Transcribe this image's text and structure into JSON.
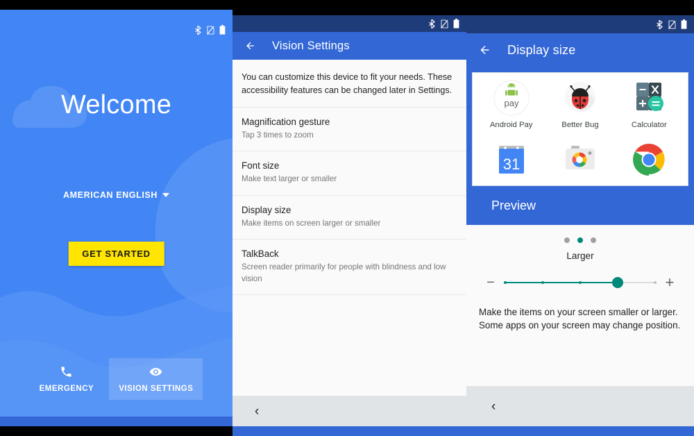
{
  "status_bar": {
    "icons": [
      "bluetooth-icon",
      "no-sim-icon",
      "battery-icon"
    ]
  },
  "colors": {
    "brand_blue": "#4285F4",
    "appbar_blue": "#3367D6",
    "status_navy": "#1F3C7A",
    "cta_yellow": "#FFE500",
    "accent_teal": "#00897B",
    "nav_gray": "#E1E4E6"
  },
  "panel1": {
    "name": "welcome-screen",
    "title": "Welcome",
    "language": "AMERICAN ENGLISH",
    "cta_label": "GET STARTED",
    "footer": [
      {
        "label": "EMERGENCY",
        "icon": "phone-icon",
        "selected": false
      },
      {
        "label": "VISION SETTINGS",
        "icon": "eye-icon",
        "selected": true
      }
    ]
  },
  "panel2": {
    "name": "vision-settings-screen",
    "appbar": {
      "title": "Vision Settings",
      "back_icon": "arrow-left-icon"
    },
    "intro": "You can customize this device to fit your needs. These accessibility features can be changed later in Settings.",
    "items": [
      {
        "title": "Magnification gesture",
        "subtitle": "Tap 3 times to zoom"
      },
      {
        "title": "Font size",
        "subtitle": "Make text larger or smaller"
      },
      {
        "title": "Display size",
        "subtitle": "Make items on screen larger or smaller"
      },
      {
        "title": "TalkBack",
        "subtitle": "Screen reader primarily for people with blindness and low vision"
      }
    ],
    "nav_back": "‹"
  },
  "panel3": {
    "name": "display-size-screen",
    "appbar": {
      "title": "Display size",
      "back_icon": "arrow-left-icon"
    },
    "preview_label": "Preview",
    "apps_row1": [
      {
        "label": "Android Pay",
        "icon": "android-pay-icon"
      },
      {
        "label": "Better Bug",
        "icon": "ladybug-icon"
      },
      {
        "label": "Calculator",
        "icon": "calculator-icon"
      }
    ],
    "apps_row2": [
      {
        "label": "",
        "icon": "calendar-icon",
        "day": "31"
      },
      {
        "label": "",
        "icon": "camera-icon"
      },
      {
        "label": "",
        "icon": "chrome-icon"
      }
    ],
    "size_label": "Larger",
    "dots_total": 3,
    "dots_active_index": 1,
    "slider": {
      "minus_label": "−",
      "plus_label": "+",
      "steps": 5,
      "value_index": 4,
      "fill_percent": 75
    },
    "description": "Make the items on your screen smaller or larger. Some apps on your screen may change position.",
    "nav_back": "‹"
  }
}
